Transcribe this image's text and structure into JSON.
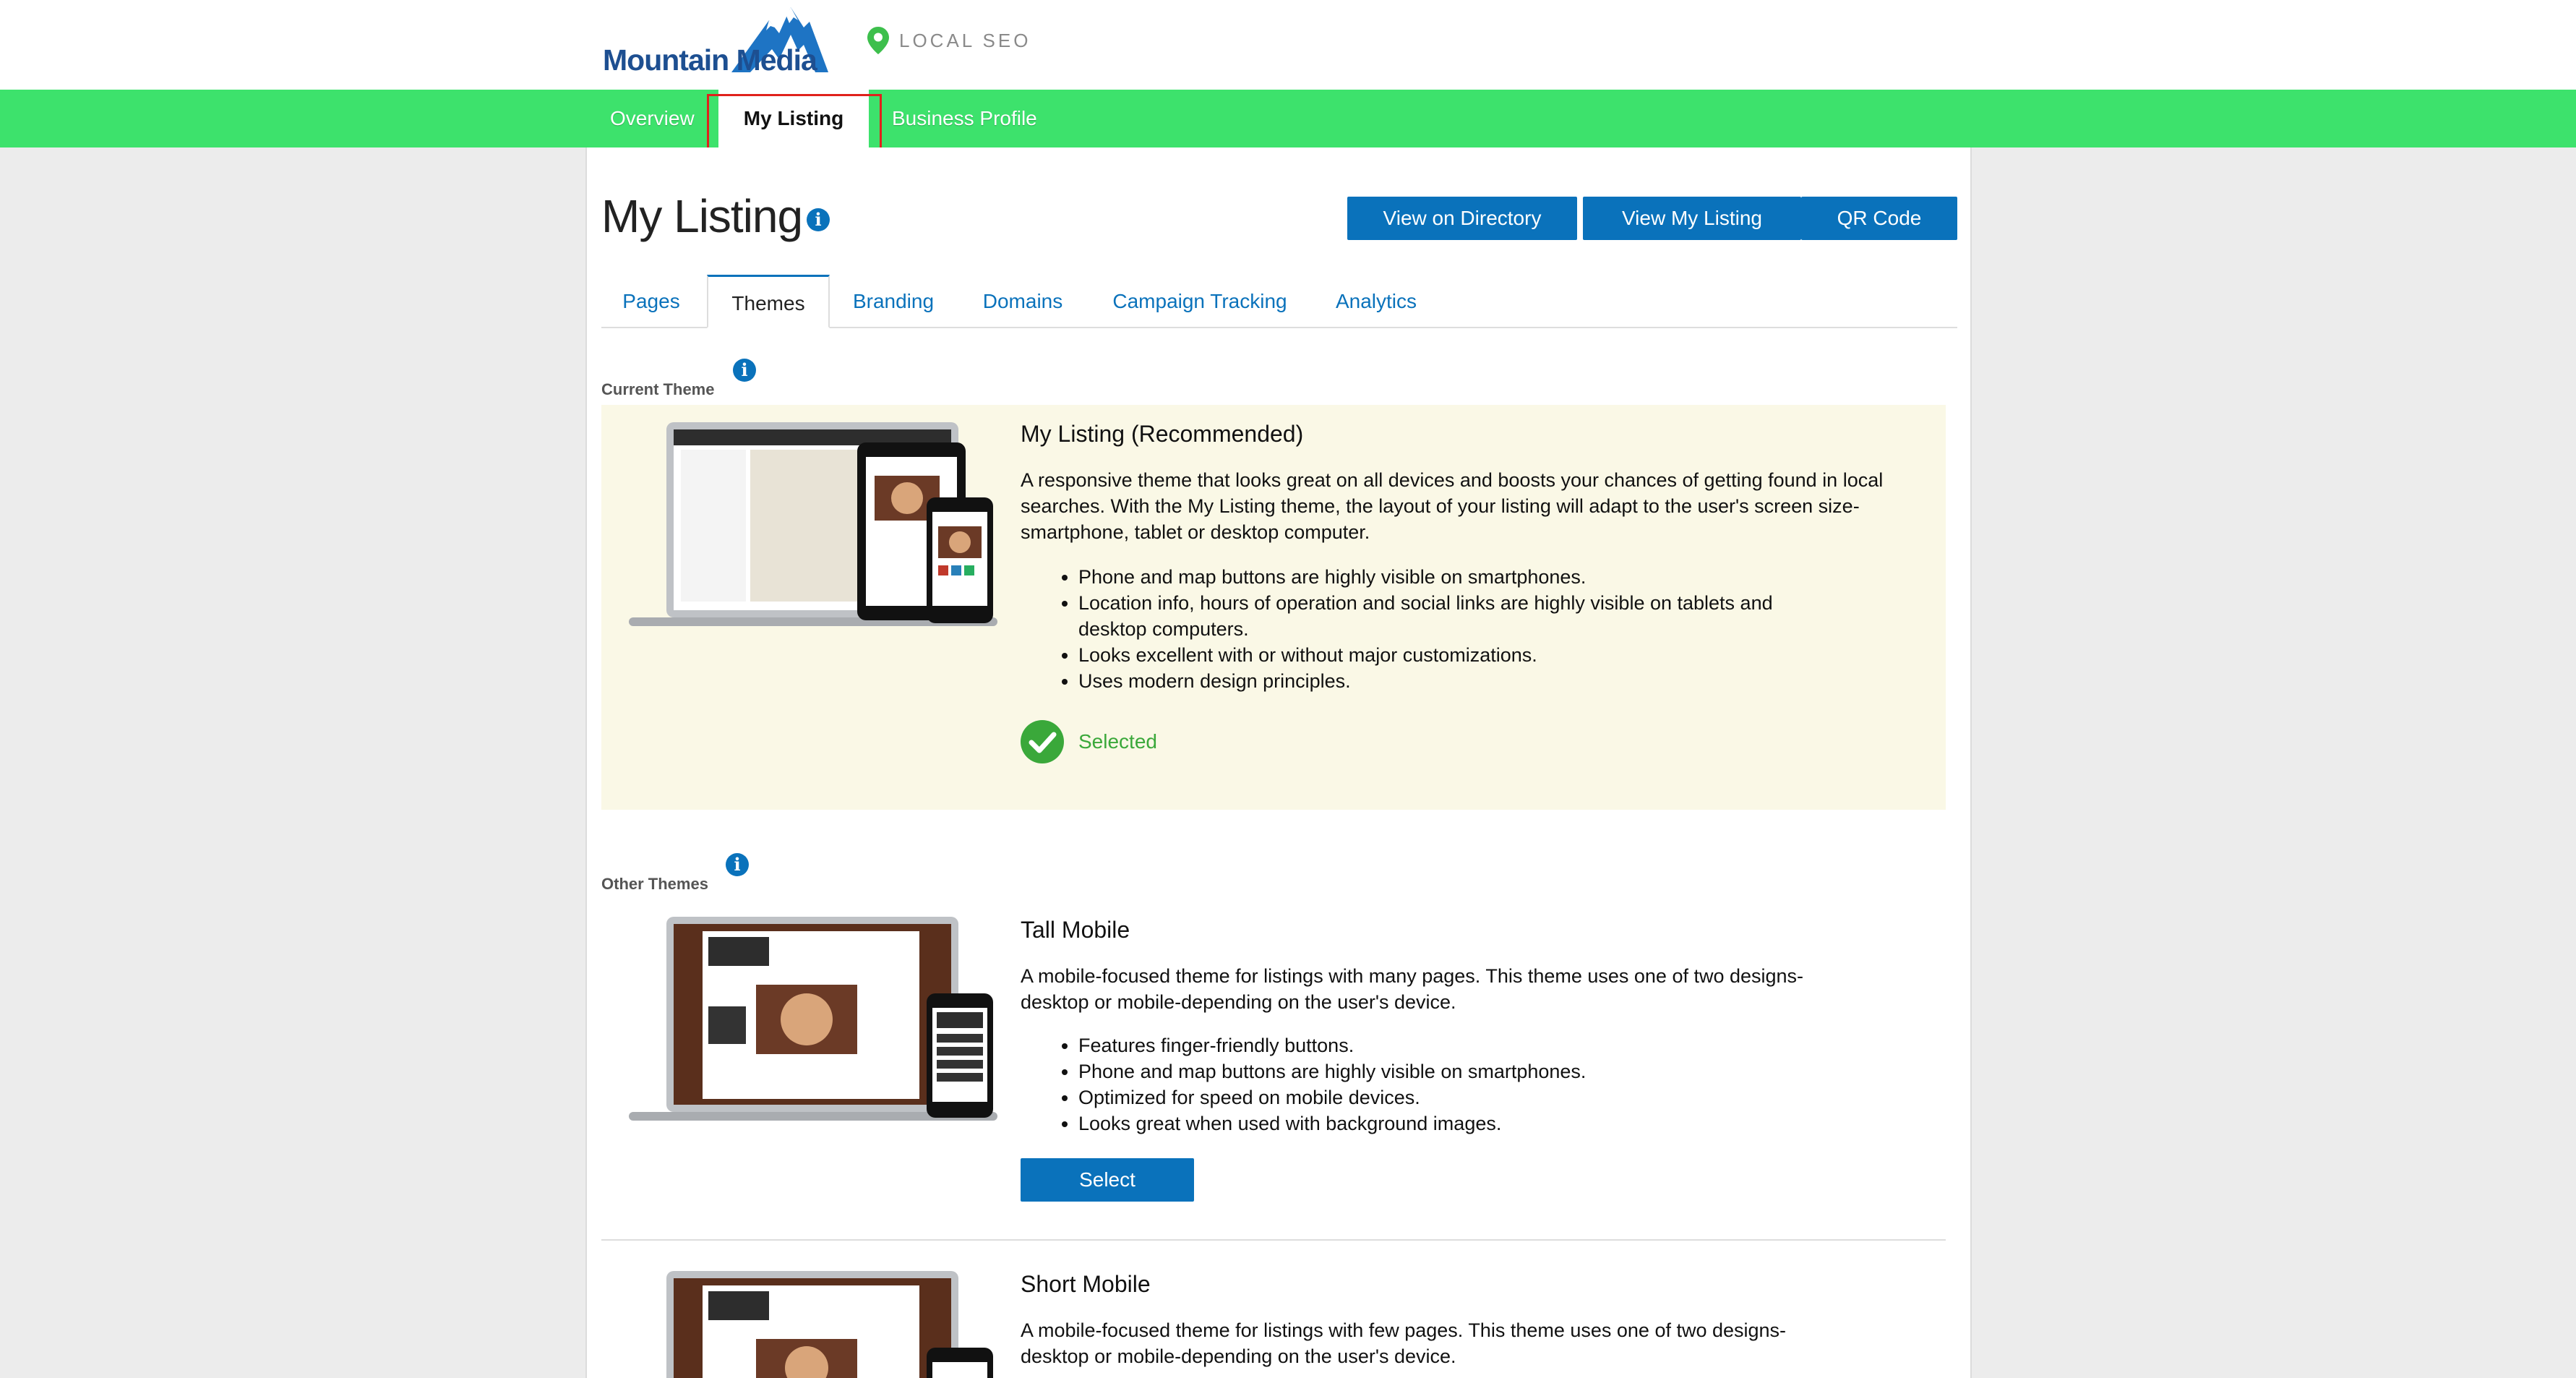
{
  "brand": {
    "logo_text": "Mountain Media",
    "product_label": "LOCAL SEO"
  },
  "nav": {
    "items": [
      "Overview",
      "My Listing",
      "Business Profile"
    ],
    "active": "My Listing"
  },
  "page": {
    "title": "My Listing",
    "actions": [
      "View on Directory",
      "View My Listing",
      "QR Code"
    ]
  },
  "tabs": {
    "items": [
      "Pages",
      "Themes",
      "Branding",
      "Domains",
      "Campaign Tracking",
      "Analytics"
    ],
    "active": "Themes"
  },
  "current_theme": {
    "section_label": "Current Theme",
    "title": "My Listing (Recommended)",
    "description": "A responsive theme that looks great on all devices and boosts your chances of getting found in local searches. With the My Listing theme, the layout of your listing will adapt to the user's screen size-smartphone, tablet or desktop computer.",
    "features": [
      "Phone and map buttons are highly visible on smartphones.",
      "Location info, hours of operation and social links are highly visible on tablets and desktop computers.",
      "Looks excellent with or without major customizations.",
      "Uses modern design principles."
    ],
    "status": "Selected"
  },
  "other_themes": {
    "section_label": "Other Themes",
    "items": [
      {
        "title": "Tall Mobile",
        "description": "A mobile-focused theme for listings with many pages. This theme uses one of two designs-desktop or mobile-depending on the user's device.",
        "features": [
          "Features finger-friendly buttons.",
          "Phone and map buttons are highly visible on smartphones.",
          "Optimized for speed on mobile devices.",
          "Looks great when used with background images."
        ],
        "button": "Select"
      },
      {
        "title": "Short Mobile",
        "description": "A mobile-focused theme for listings with few pages. This theme uses one of two designs-desktop or mobile-depending on the user's device."
      }
    ]
  },
  "colors": {
    "nav_green": "#3de26c",
    "primary_blue": "#0a72bb",
    "selected_green": "#3aa83a",
    "current_panel": "#faf8e6",
    "highlight_red": "#e0211c"
  },
  "icons": [
    "mountain-logo-icon",
    "map-pin-icon",
    "info-icon",
    "check-circle-icon"
  ]
}
